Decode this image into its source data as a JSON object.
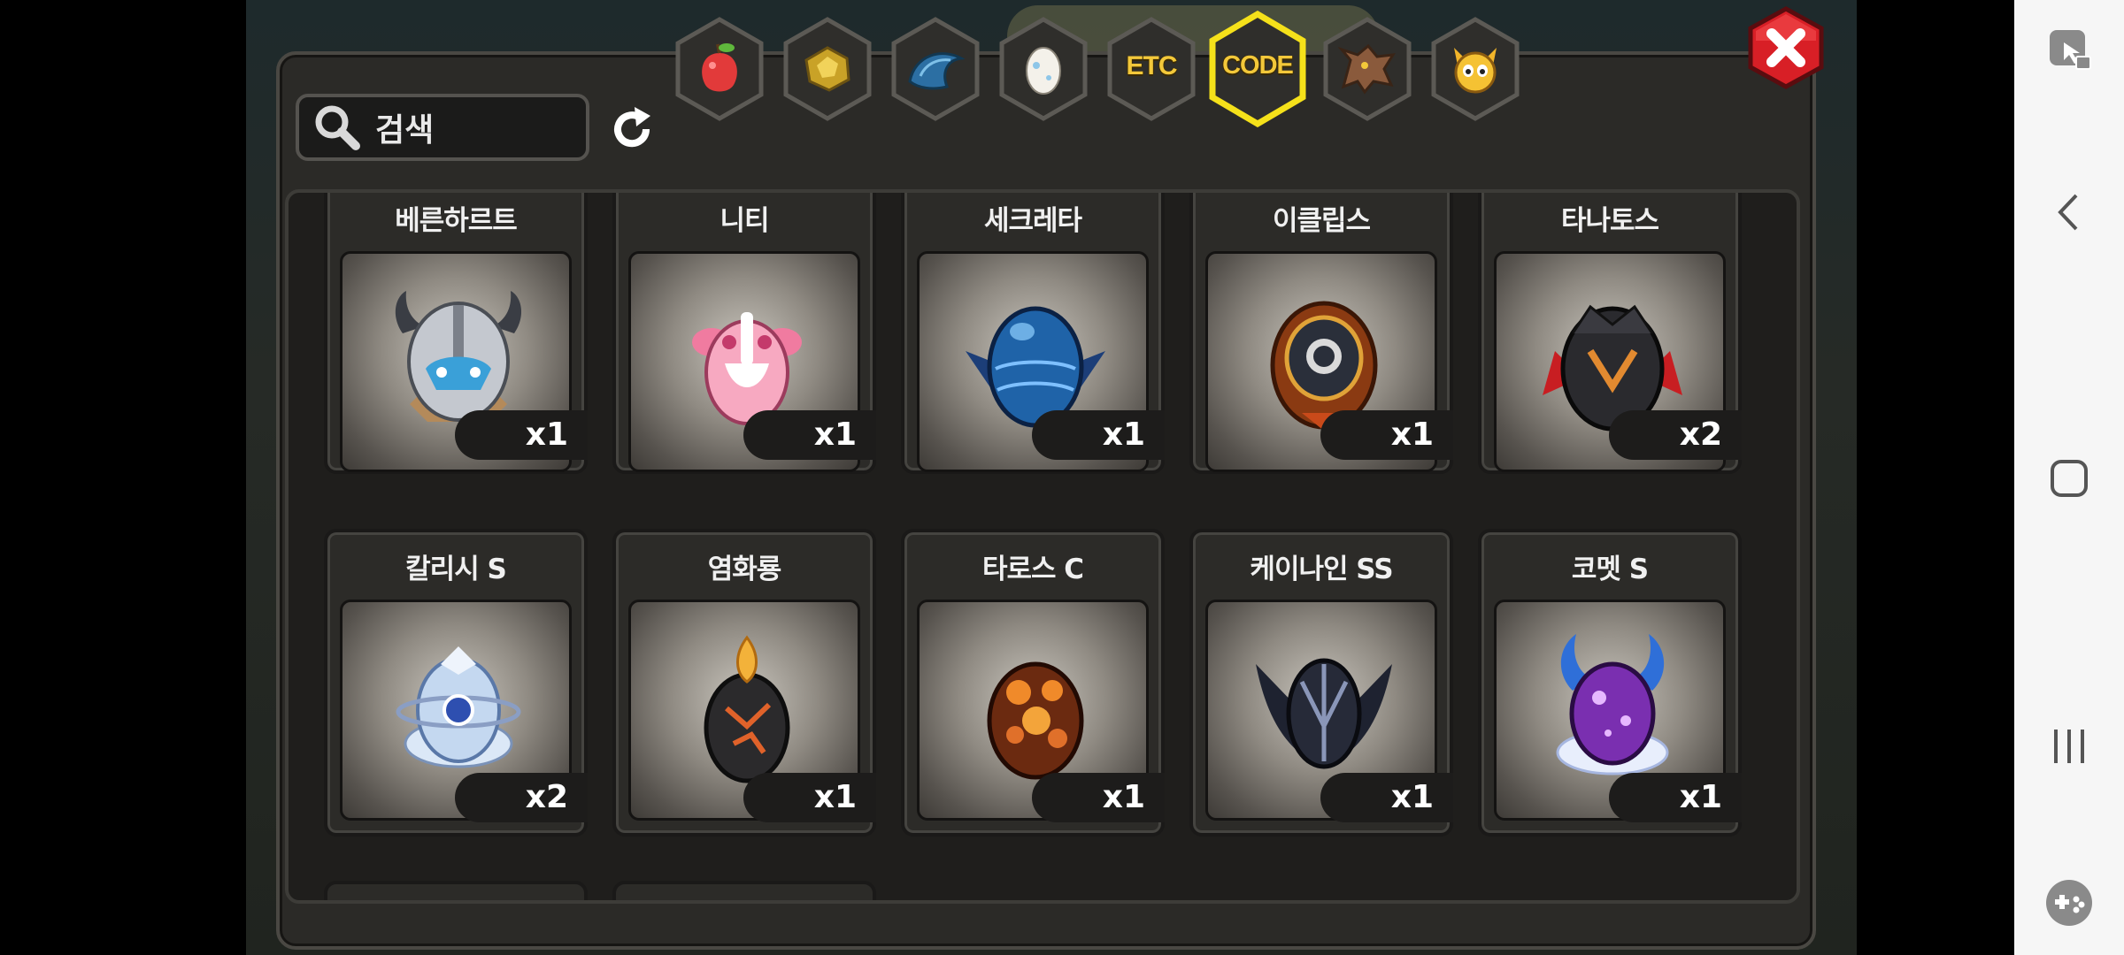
{
  "search": {
    "label": "검색",
    "icon": "search-icon"
  },
  "refresh": {
    "icon": "refresh-icon"
  },
  "tabs": [
    {
      "id": "fruit",
      "icon": "fruit-icon",
      "text": ""
    },
    {
      "id": "ore",
      "icon": "gold-ore-icon",
      "text": ""
    },
    {
      "id": "scale",
      "icon": "dragon-scale-icon",
      "text": ""
    },
    {
      "id": "egg",
      "icon": "egg-icon",
      "text": ""
    },
    {
      "id": "etc",
      "icon": "",
      "text": "ETC"
    },
    {
      "id": "code",
      "icon": "",
      "text": "CODE",
      "selected": true
    },
    {
      "id": "dragon",
      "icon": "dragon-head-icon",
      "text": ""
    },
    {
      "id": "pet",
      "icon": "pet-face-icon",
      "text": ""
    }
  ],
  "close": {
    "icon": "close-icon"
  },
  "items": [
    {
      "name": "베른하르트",
      "qty": "x1",
      "icon": "horned-helmet-egg-icon"
    },
    {
      "name": "니티",
      "qty": "x1",
      "icon": "pink-egg-icon"
    },
    {
      "name": "세크레타",
      "qty": "x1",
      "icon": "blue-winged-egg-icon"
    },
    {
      "name": "이클립스",
      "qty": "x1",
      "icon": "eclipse-egg-icon"
    },
    {
      "name": "타나토스",
      "qty": "x2",
      "icon": "dark-red-egg-icon"
    },
    {
      "name": "칼리시 S",
      "qty": "x2",
      "icon": "crystal-egg-icon"
    },
    {
      "name": "염화룡",
      "qty": "x1",
      "icon": "flame-egg-icon"
    },
    {
      "name": "타로스 C",
      "qty": "x1",
      "icon": "lava-egg-icon"
    },
    {
      "name": "케이나인 SS",
      "qty": "x1",
      "icon": "shadow-egg-icon"
    },
    {
      "name": "코멧 S",
      "qty": "x1",
      "icon": "purple-comet-egg-icon"
    }
  ],
  "colors": {
    "panel": "#2b2a27",
    "selected_tab_border": "#f5e11a",
    "tab_text": "#f3c83a",
    "close_red": "#d81f26"
  },
  "system_nav": {
    "icons": [
      "game-touch-lock-icon",
      "back-icon",
      "home-icon",
      "recents-icon",
      "game-tools-icon"
    ]
  }
}
